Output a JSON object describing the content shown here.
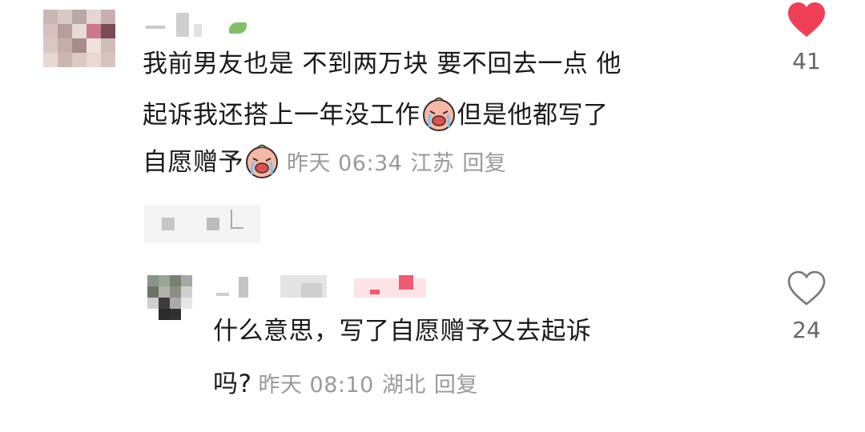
{
  "comments": [
    {
      "text_line1": "我前男友也是 不到两万块 要不回去一点 他",
      "text_line2": "起诉我还搭上一年没工作",
      "text_line2_after": "但是他都写了",
      "text_line3": "自愿赠予",
      "time": "昨天 06:34",
      "location": "江苏",
      "reply_label": "回复",
      "likes": "41",
      "liked": true,
      "like_icon": "heart-filled-icon",
      "emoji_icon": "crying-face-emoji"
    },
    {
      "text_line1": "什么意思，写了自愿赠予又去起诉",
      "text_line2": "吗?",
      "time": "昨天 08:10",
      "location": "湖北",
      "reply_label": "回复",
      "likes": "24",
      "liked": false,
      "like_icon": "heart-outline-icon"
    }
  ],
  "colors": {
    "heart_red": "#ef4057",
    "meta_gray": "#9a9a9a",
    "text": "#1a1a1a"
  }
}
